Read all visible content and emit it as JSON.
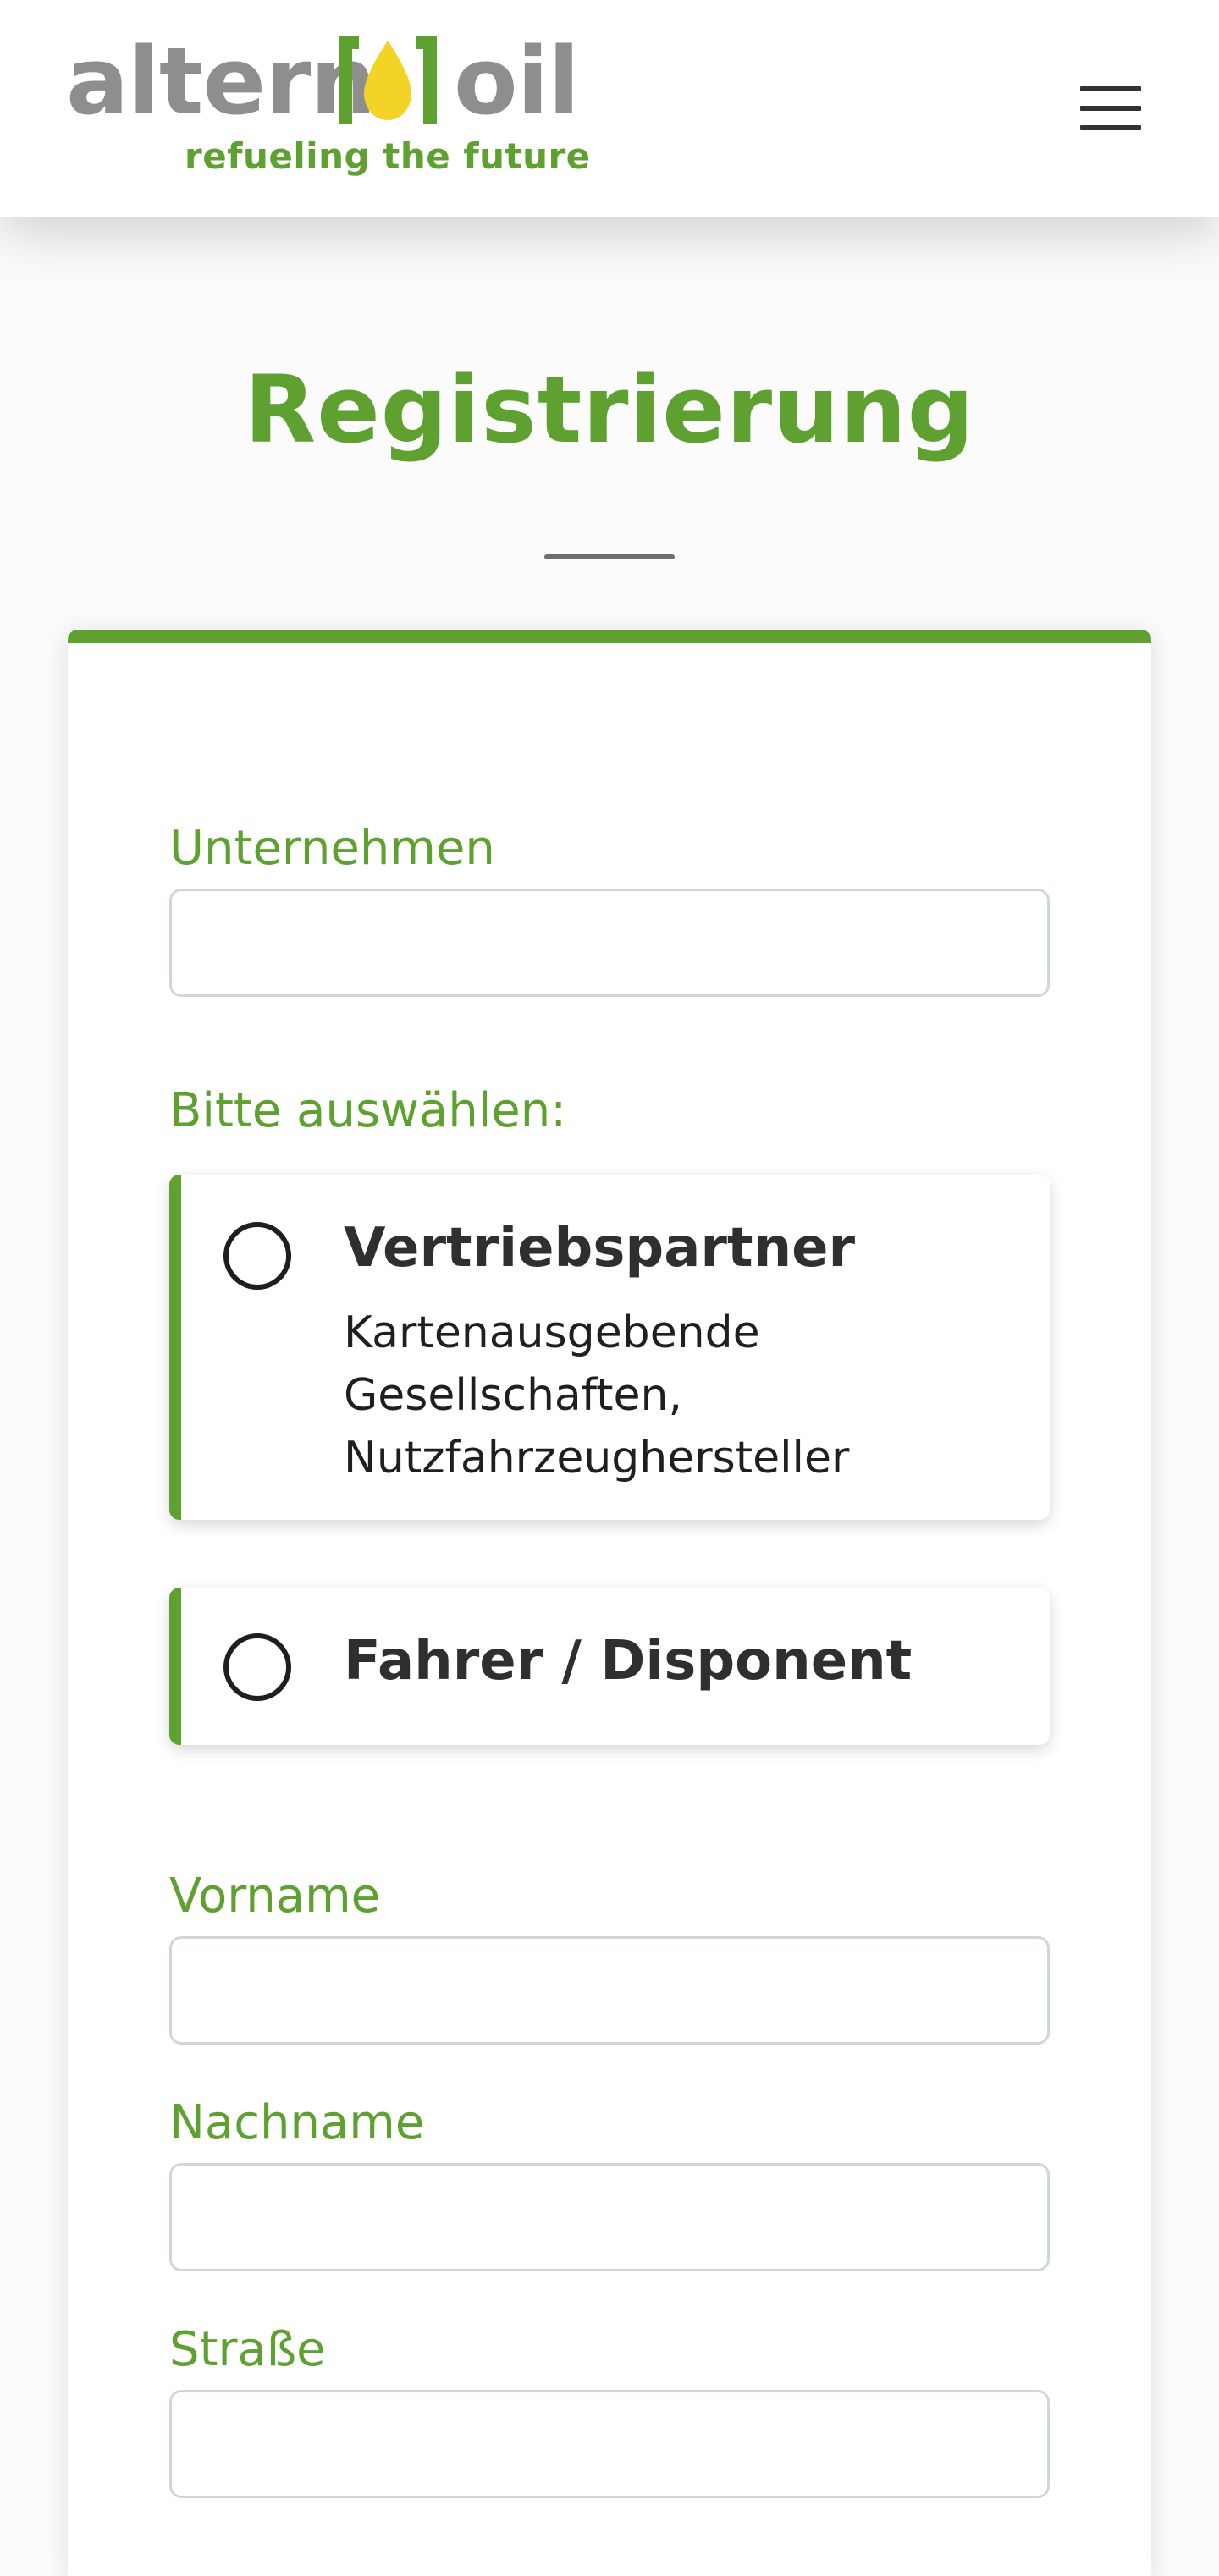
{
  "header": {
    "logo": {
      "word_left": "altern",
      "word_right": "oil",
      "tagline": "refueling the future"
    },
    "menu_icon": "hamburger-menu-icon"
  },
  "page": {
    "title": "Registrierung"
  },
  "form": {
    "company": {
      "label": "Unternehmen",
      "value": "",
      "placeholder": ""
    },
    "select_label": "Bitte auswählen:",
    "options": [
      {
        "title": "Vertriebspartner",
        "description": "Kartenausgebende Gesellschaften, Nutzfahrzeughersteller",
        "selected": false
      },
      {
        "title": "Fahrer / Disponent",
        "description": "",
        "selected": false
      }
    ],
    "first_name": {
      "label": "Vorname",
      "value": "",
      "placeholder": ""
    },
    "last_name": {
      "label": "Nachname",
      "value": "",
      "placeholder": ""
    },
    "street": {
      "label": "Straße",
      "value": "",
      "placeholder": ""
    }
  },
  "colors": {
    "brand_green": "#5ea130",
    "logo_gray": "#8e8e8e",
    "drop_yellow": "#f3d325"
  }
}
